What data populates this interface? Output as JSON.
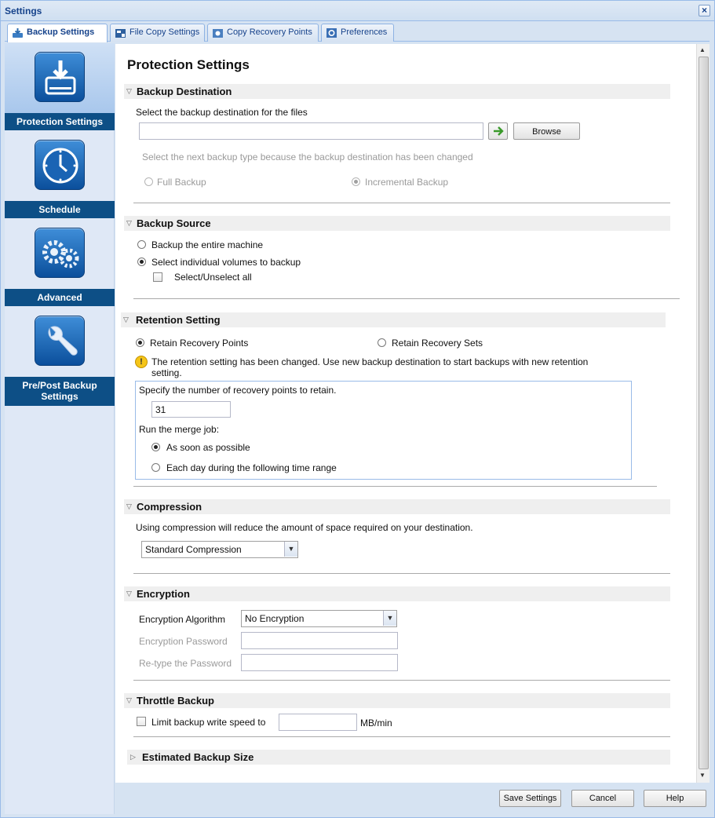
{
  "window": {
    "title": "Settings"
  },
  "tabs": [
    {
      "label": "Backup Settings",
      "icon": "backup-icon"
    },
    {
      "label": "File Copy Settings",
      "icon": "file-copy-icon"
    },
    {
      "label": "Copy Recovery Points",
      "icon": "copy-recovery-icon"
    },
    {
      "label": "Preferences",
      "icon": "preferences-icon"
    }
  ],
  "sidebar": {
    "items": [
      {
        "label": "Protection Settings",
        "icon": "drive-download-icon"
      },
      {
        "label": "Schedule",
        "icon": "clock-icon"
      },
      {
        "label": "Advanced",
        "icon": "gears-icon"
      },
      {
        "label": "Pre/Post Backup Settings",
        "icon": "wrench-icon"
      }
    ]
  },
  "main": {
    "title": "Protection Settings",
    "destination": {
      "header": "Backup Destination",
      "prompt": "Select the backup destination for the files",
      "path_value": "",
      "browse_label": "Browse",
      "notice": "Select the next backup type because the backup destination has been changed",
      "full_label": "Full Backup",
      "incremental_label": "Incremental Backup",
      "selected_type": "incremental"
    },
    "source": {
      "header": "Backup Source",
      "entire_label": "Backup the entire machine",
      "individual_label": "Select individual volumes to backup",
      "select_all_label": "Select/Unselect all",
      "selected": "individual"
    },
    "retention": {
      "header": "Retention Setting",
      "points_label": "Retain Recovery Points",
      "sets_label": "Retain Recovery Sets",
      "selected": "points",
      "warning": "The retention setting has been changed. Use new backup destination to start backups with new retention",
      "warning_cont": "setting.",
      "count_label": "Specify the number of recovery points to retain.",
      "count_value": "31",
      "merge_label": "Run the merge job:",
      "asap_label": "As soon as possible",
      "daily_label": "Each day during the following time range",
      "merge_selected": "asap"
    },
    "compression": {
      "header": "Compression",
      "description": "Using compression will reduce the amount of space required on your destination.",
      "selected": "Standard Compression"
    },
    "encryption": {
      "header": "Encryption",
      "algorithm_label": "Encryption Algorithm",
      "algorithm_value": "No Encryption",
      "password_label": "Encryption Password",
      "retype_label": "Re-type the Password"
    },
    "throttle": {
      "header": "Throttle Backup",
      "limit_label": "Limit backup write speed to",
      "unit": "MB/min",
      "value": ""
    },
    "estimated": {
      "header": "Estimated Backup Size"
    }
  },
  "footer": {
    "save_label": "Save Settings",
    "cancel_label": "Cancel",
    "help_label": "Help"
  },
  "colors": {
    "nav_label_bg": "#0d4f86",
    "accent": "#15428b",
    "section_bg": "#efefef"
  }
}
